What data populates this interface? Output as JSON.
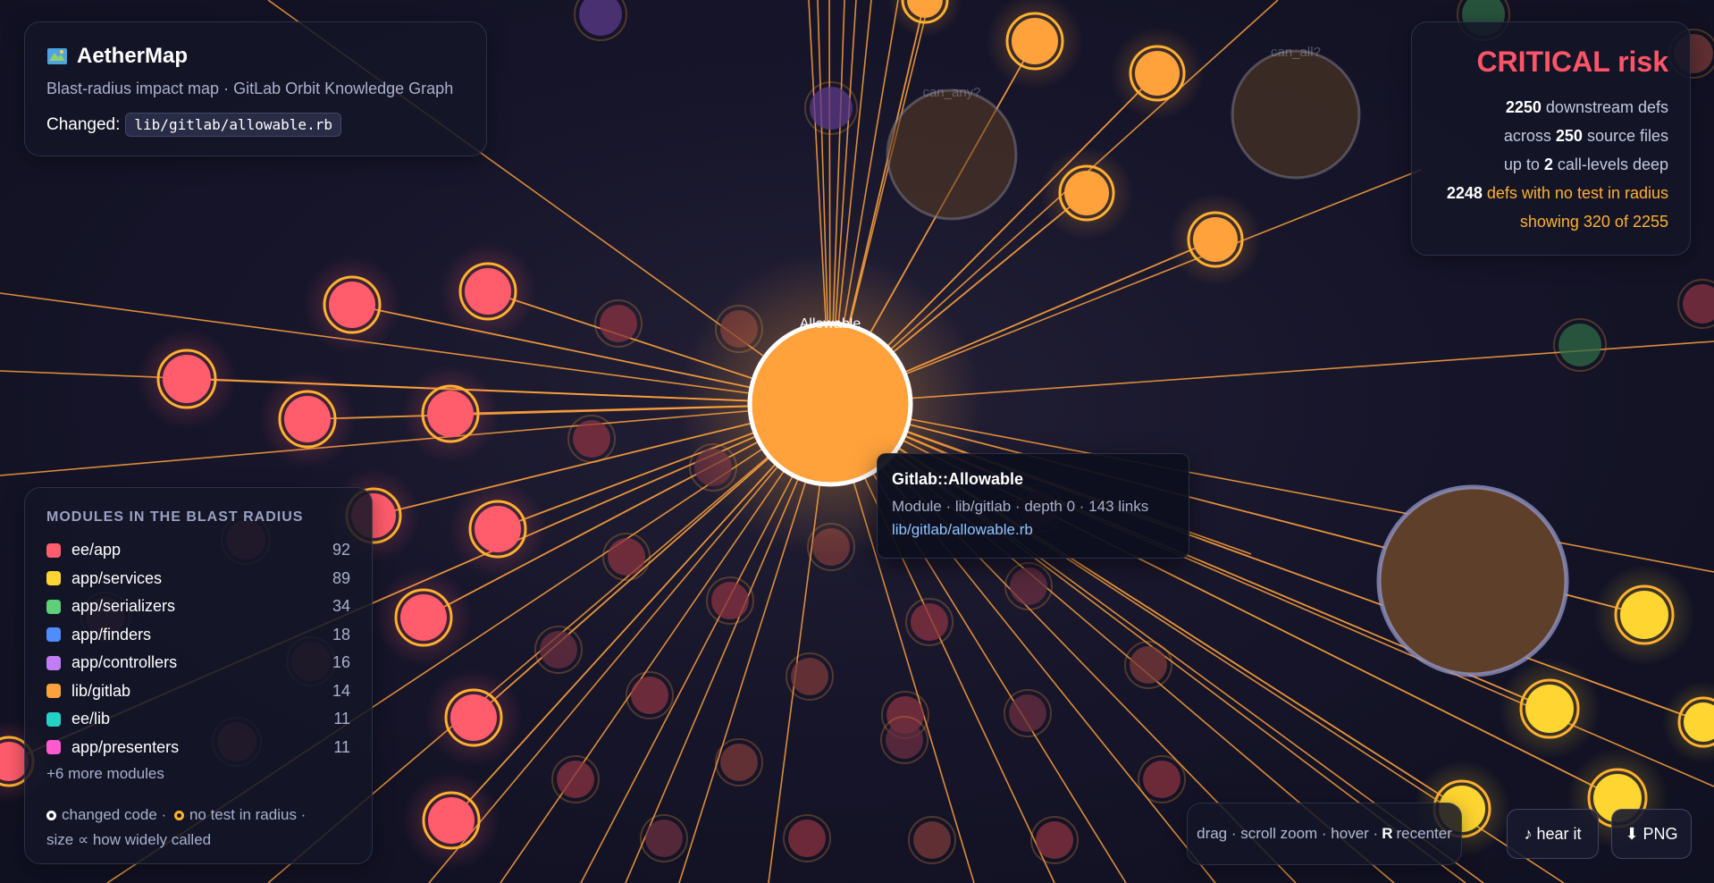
{
  "app": {
    "icon": "map-icon",
    "title": "AetherMap",
    "subtitle": "Blast-radius impact map · GitLab Orbit Knowledge Graph",
    "changed_label": "Changed:",
    "changed_path": "lib/gitlab/allowable.rb"
  },
  "risk": {
    "title": "CRITICAL risk",
    "downstream_defs": "2250",
    "downstream_defs_label": "downstream defs",
    "across_label": "across",
    "source_files": "250",
    "source_files_label": "source files",
    "upto_label": "up to",
    "call_levels": "2",
    "call_levels_label": "call-levels deep",
    "untested_defs": "2248",
    "untested_label": "defs with no test in radius",
    "showing": "showing 320 of 2255"
  },
  "legend": {
    "heading": "MODULES IN THE BLAST RADIUS",
    "modules": [
      {
        "name": "ee/app",
        "count": "92",
        "color": "#ff5c6c"
      },
      {
        "name": "app/services",
        "count": "89",
        "color": "#ffd531"
      },
      {
        "name": "app/serializers",
        "count": "34",
        "color": "#5fcf78"
      },
      {
        "name": "app/finders",
        "count": "18",
        "color": "#4f8dff"
      },
      {
        "name": "app/controllers",
        "count": "16",
        "color": "#c07df5"
      },
      {
        "name": "lib/gitlab",
        "count": "14",
        "color": "#ffa23c"
      },
      {
        "name": "ee/lib",
        "count": "11",
        "color": "#22d3c5"
      },
      {
        "name": "app/presenters",
        "count": "11",
        "color": "#ff5ad0"
      }
    ],
    "more": "+6 more modules",
    "key_changed": "changed code ·",
    "key_untested": "no test in radius ·",
    "key_size": "size ∝ how widely called"
  },
  "graph": {
    "center_label": "Allowable",
    "ghost_label_1": "can_any?",
    "ghost_label_2": "can_all?"
  },
  "tooltip": {
    "title": "Gitlab::Allowable",
    "meta": "Module · lib/gitlab · depth 0 · 143 links",
    "path": "lib/gitlab/allowable.rb"
  },
  "controls": {
    "help_drag": "drag · scroll zoom · hover ·",
    "help_key": "R",
    "help_recenter": "recenter",
    "hear_label": "♪ hear it",
    "png_label": "⬇ PNG"
  },
  "colors": {
    "edge": "#ffa23c",
    "changed_ring": "#ffffff",
    "untested_ring": "#ffb02e",
    "critical": "#ff5468"
  }
}
